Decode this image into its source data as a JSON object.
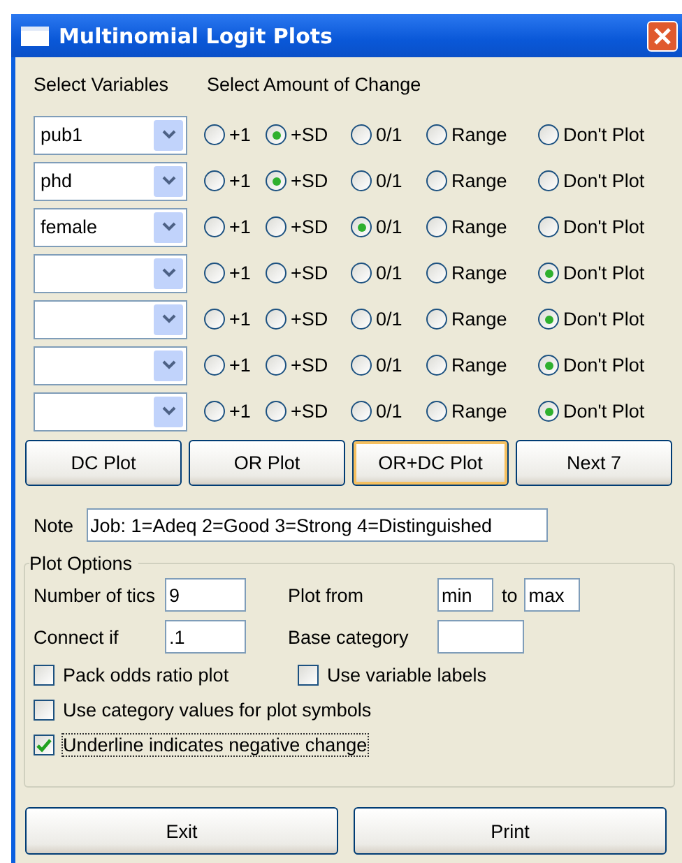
{
  "window": {
    "title": "Multinomial Logit Plots"
  },
  "headers": [
    "Select Variables",
    "Select Amount of Change"
  ],
  "rows": [
    {
      "variable": "pub1",
      "options": [
        {
          "label": "+1",
          "selected": false
        },
        {
          "label": "+SD",
          "selected": true
        },
        {
          "label": "0/1",
          "selected": false
        },
        {
          "label": "Range",
          "selected": false
        },
        {
          "label": "Don't Plot",
          "selected": false
        }
      ]
    },
    {
      "variable": "phd",
      "options": [
        {
          "label": "+1",
          "selected": false
        },
        {
          "label": "+SD",
          "selected": true
        },
        {
          "label": "0/1",
          "selected": false
        },
        {
          "label": "Range",
          "selected": false
        },
        {
          "label": "Don't Plot",
          "selected": false
        }
      ]
    },
    {
      "variable": "female",
      "options": [
        {
          "label": "+1",
          "selected": false
        },
        {
          "label": "+SD",
          "selected": false
        },
        {
          "label": "0/1",
          "selected": true
        },
        {
          "label": "Range",
          "selected": false
        },
        {
          "label": "Don't Plot",
          "selected": false
        }
      ]
    },
    {
      "options": [
        {
          "label": "+1",
          "selected": false
        },
        {
          "label": "+SD",
          "selected": false
        },
        {
          "label": "0/1",
          "selected": false
        },
        {
          "label": "Range",
          "selected": false
        },
        {
          "label": "Don't Plot",
          "selected": true
        }
      ]
    },
    {
      "options": [
        {
          "label": "+1",
          "selected": false
        },
        {
          "label": "+SD",
          "selected": false
        },
        {
          "label": "0/1",
          "selected": false
        },
        {
          "label": "Range",
          "selected": false
        },
        {
          "label": "Don't Plot",
          "selected": true
        }
      ]
    },
    {
      "options": [
        {
          "label": "+1",
          "selected": false
        },
        {
          "label": "+SD",
          "selected": false
        },
        {
          "label": "0/1",
          "selected": false
        },
        {
          "label": "Range",
          "selected": false
        },
        {
          "label": "Don't Plot",
          "selected": true
        }
      ]
    },
    {
      "options": [
        {
          "label": "+1",
          "selected": false
        },
        {
          "label": "+SD",
          "selected": false
        },
        {
          "label": "0/1",
          "selected": false
        },
        {
          "label": "Range",
          "selected": false
        },
        {
          "label": "Don't Plot",
          "selected": true
        }
      ]
    }
  ],
  "plot_buttons": [
    {
      "label": "DC Plot",
      "focused": false
    },
    {
      "label": "OR Plot",
      "focused": false
    },
    {
      "label": "OR+DC Plot",
      "focused": true
    },
    {
      "label": "Next 7",
      "focused": false
    }
  ],
  "note": {
    "label": "Note",
    "value": "Job: 1=Adeq 2=Good 3=Strong 4=Distinguished"
  },
  "plot_options": {
    "title": "Plot Options",
    "number_of_tics": {
      "label": "Number of tics",
      "value": "9"
    },
    "plot_from": {
      "label": "Plot from",
      "value": "min"
    },
    "plot_to": {
      "label": "to",
      "value": "max"
    },
    "connect_if": {
      "label": "Connect if",
      "value": ".1"
    },
    "base_category": {
      "label": "Base category"
    },
    "checkboxes": [
      {
        "label": "Pack odds ratio plot",
        "checked": false,
        "focused": false
      },
      {
        "label": "Use variable labels",
        "checked": false,
        "focused": false
      },
      {
        "label": "Use category values for plot symbols",
        "checked": false,
        "focused": false
      },
      {
        "label": "Underline indicates negative change",
        "checked": true,
        "focused": true
      }
    ]
  },
  "bottom_buttons": [
    "Exit",
    "Print"
  ]
}
